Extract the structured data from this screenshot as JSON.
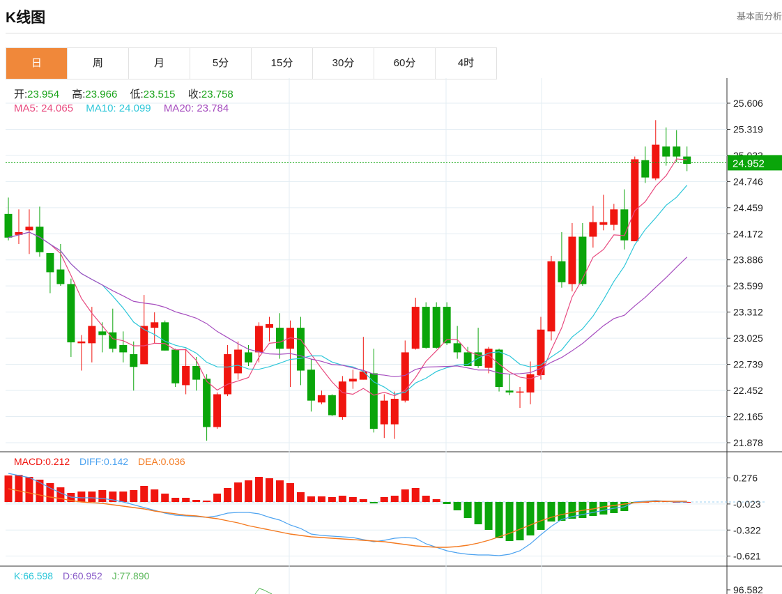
{
  "header": {
    "title": "K线图",
    "right_link": "基本面分析"
  },
  "tabs": [
    {
      "label": "日",
      "active": true
    },
    {
      "label": "周"
    },
    {
      "label": "月"
    },
    {
      "label": "5分"
    },
    {
      "label": "15分"
    },
    {
      "label": "30分"
    },
    {
      "label": "60分"
    },
    {
      "label": "4时"
    }
  ],
  "ohlc_info": {
    "open_label": "开:",
    "open": "23.954",
    "high_label": "高:",
    "high": "23.966",
    "low_label": "低:",
    "low": "23.515",
    "close_label": "收:",
    "close": "23.758"
  },
  "ma_info": {
    "ma5": "MA5: 24.065",
    "ma10": "MA10: 24.099",
    "ma20": "MA20: 23.784"
  },
  "macd_info": {
    "macd": "MACD:0.212",
    "diff": "DIFF:0.142",
    "dea": "DEA:0.036"
  },
  "kdj_info": {
    "k": "K:66.598",
    "d": "D:60.952",
    "j": "J:77.890"
  },
  "colors": {
    "up": "#f0150f",
    "down": "#0aa50a",
    "ma5": "#e84a7f",
    "ma10": "#2ec7d9",
    "ma20": "#a64dbf",
    "diff": "#4da3f0",
    "dea": "#f47a20",
    "accent": "#f0883a"
  },
  "chart_data": {
    "type": "candlestick",
    "price_ticks": [
      "25.606",
      "25.319",
      "25.033",
      "24.746",
      "24.459",
      "24.172",
      "23.886",
      "23.599",
      "23.312",
      "23.025",
      "22.739",
      "22.452",
      "22.165",
      "21.878"
    ],
    "price_range": [
      21.878,
      25.606
    ],
    "current_price": "24.952",
    "candles": [
      [
        24.39,
        24.13,
        24.57,
        24.1
      ],
      [
        24.16,
        24.19,
        24.44,
        24.06
      ],
      [
        24.21,
        24.25,
        24.44,
        23.95
      ],
      [
        24.25,
        23.97,
        24.47,
        23.92
      ],
      [
        23.96,
        23.75,
        23.96,
        23.52
      ],
      [
        23.78,
        23.62,
        24.06,
        23.6
      ],
      [
        23.62,
        22.98,
        23.68,
        22.82
      ],
      [
        22.97,
        22.99,
        23.06,
        22.67
      ],
      [
        22.97,
        23.16,
        23.37,
        22.76
      ],
      [
        23.1,
        23.06,
        23.2,
        22.87
      ],
      [
        23.09,
        22.91,
        23.35,
        22.87
      ],
      [
        22.95,
        22.87,
        23.1,
        22.76
      ],
      [
        22.85,
        22.71,
        22.99,
        22.45
      ],
      [
        22.74,
        23.16,
        23.5,
        22.74
      ],
      [
        23.14,
        23.2,
        23.31,
        22.97
      ],
      [
        23.2,
        22.89,
        23.22,
        22.89
      ],
      [
        22.9,
        22.53,
        22.91,
        22.49
      ],
      [
        22.51,
        22.72,
        22.91,
        22.41
      ],
      [
        22.72,
        22.57,
        22.82,
        22.45
      ],
      [
        22.58,
        22.05,
        22.63,
        21.9
      ],
      [
        22.05,
        22.41,
        22.43,
        22.03
      ],
      [
        22.41,
        22.85,
        22.95,
        22.39
      ],
      [
        22.64,
        22.9,
        22.99,
        22.57
      ],
      [
        22.87,
        22.76,
        22.95,
        22.72
      ],
      [
        22.87,
        23.16,
        23.2,
        22.76
      ],
      [
        23.14,
        23.18,
        23.26,
        22.99
      ],
      [
        23.14,
        22.91,
        23.3,
        22.8
      ],
      [
        22.91,
        23.14,
        23.22,
        22.49
      ],
      [
        23.14,
        22.67,
        23.26,
        22.51
      ],
      [
        22.68,
        22.34,
        22.8,
        22.22
      ],
      [
        22.32,
        22.4,
        22.45,
        22.3
      ],
      [
        22.4,
        22.18,
        22.41,
        22.17
      ],
      [
        22.16,
        22.55,
        22.61,
        22.13
      ],
      [
        22.55,
        22.58,
        22.68,
        22.47
      ],
      [
        22.57,
        22.66,
        23.04,
        22.57
      ],
      [
        22.64,
        22.03,
        22.91,
        21.99
      ],
      [
        22.08,
        22.34,
        22.41,
        21.93
      ],
      [
        22.08,
        22.36,
        22.44,
        21.92
      ],
      [
        22.34,
        22.87,
        23.0,
        22.32
      ],
      [
        22.91,
        23.37,
        23.47,
        22.9
      ],
      [
        23.37,
        22.92,
        23.42,
        22.91
      ],
      [
        23.37,
        22.92,
        23.42,
        22.91
      ],
      [
        23.37,
        22.97,
        23.42,
        22.95
      ],
      [
        22.97,
        22.87,
        23.16,
        22.8
      ],
      [
        22.87,
        22.72,
        22.93,
        22.72
      ],
      [
        22.87,
        22.72,
        23.14,
        22.7
      ],
      [
        22.7,
        22.91,
        22.93,
        22.64
      ],
      [
        22.9,
        22.49,
        22.91,
        22.44
      ],
      [
        22.45,
        22.43,
        22.63,
        22.4
      ],
      [
        22.43,
        22.44,
        22.49,
        22.26
      ],
      [
        22.43,
        22.63,
        22.77,
        22.3
      ],
      [
        22.62,
        23.12,
        23.26,
        22.57
      ],
      [
        23.1,
        23.87,
        23.93,
        23.0
      ],
      [
        23.87,
        23.64,
        24.19,
        23.58
      ],
      [
        23.62,
        24.14,
        24.29,
        23.54
      ],
      [
        24.14,
        23.62,
        24.29,
        23.6
      ],
      [
        24.14,
        24.3,
        24.48,
        24.02
      ],
      [
        24.27,
        24.3,
        24.6,
        24.21
      ],
      [
        24.27,
        24.44,
        24.5,
        24.21
      ],
      [
        24.44,
        24.1,
        24.66,
        24.0
      ],
      [
        24.09,
        24.99,
        25.02,
        24.09
      ],
      [
        24.98,
        24.79,
        25.13,
        24.73
      ],
      [
        24.78,
        25.15,
        25.42,
        24.76
      ],
      [
        25.13,
        25.02,
        25.34,
        24.92
      ],
      [
        25.13,
        25.02,
        25.31,
        24.96
      ],
      [
        25.02,
        24.94,
        25.13,
        24.86
      ]
    ],
    "macd_ticks": [
      "0.276",
      "-0.023",
      "-0.322",
      "-0.621"
    ],
    "macd_hist": [
      0.304,
      0.312,
      0.288,
      0.256,
      0.216,
      0.168,
      0.104,
      0.12,
      0.12,
      0.136,
      0.12,
      0.12,
      0.136,
      0.184,
      0.144,
      0.096,
      0.048,
      0.048,
      0.024,
      0.016,
      0.096,
      0.16,
      0.224,
      0.248,
      0.288,
      0.272,
      0.248,
      0.216,
      0.112,
      0.064,
      0.064,
      0.056,
      0.072,
      0.056,
      0.032,
      -0.016,
      0.056,
      0.072,
      0.144,
      0.16,
      0.072,
      0.032,
      -0.024,
      -0.096,
      -0.184,
      -0.256,
      -0.32,
      -0.416,
      -0.448,
      -0.44,
      -0.384,
      -0.32,
      -0.224,
      -0.216,
      -0.192,
      -0.184,
      -0.16,
      -0.144,
      -0.128,
      -0.104,
      -0.008,
      0,
      0.016,
      0.008,
      0,
      0
    ],
    "diff": [
      0.328,
      0.304,
      0.28,
      0.224,
      0.16,
      0.104,
      0.056,
      0.048,
      0.048,
      0.04,
      0.024,
      0,
      -0.032,
      -0.064,
      -0.096,
      -0.128,
      -0.152,
      -0.16,
      -0.168,
      -0.176,
      -0.16,
      -0.128,
      -0.12,
      -0.12,
      -0.136,
      -0.176,
      -0.208,
      -0.264,
      -0.304,
      -0.368,
      -0.384,
      -0.392,
      -0.4,
      -0.408,
      -0.432,
      -0.456,
      -0.44,
      -0.416,
      -0.408,
      -0.416,
      -0.48,
      -0.52,
      -0.56,
      -0.584,
      -0.6,
      -0.608,
      -0.608,
      -0.616,
      -0.6,
      -0.56,
      -0.48,
      -0.376,
      -0.28,
      -0.2,
      -0.168,
      -0.144,
      -0.12,
      -0.096,
      -0.072,
      -0.056,
      0,
      0.008,
      0.016,
      0.008,
      0,
      0
    ],
    "dea": [
      0.152,
      0.128,
      0.104,
      0.08,
      0.056,
      0.04,
      0.016,
      0,
      -0.008,
      -0.016,
      -0.032,
      -0.048,
      -0.064,
      -0.08,
      -0.104,
      -0.12,
      -0.136,
      -0.152,
      -0.16,
      -0.176,
      -0.192,
      -0.216,
      -0.24,
      -0.272,
      -0.296,
      -0.32,
      -0.344,
      -0.368,
      -0.384,
      -0.4,
      -0.408,
      -0.416,
      -0.424,
      -0.432,
      -0.44,
      -0.448,
      -0.456,
      -0.472,
      -0.488,
      -0.504,
      -0.512,
      -0.52,
      -0.52,
      -0.512,
      -0.496,
      -0.472,
      -0.44,
      -0.4,
      -0.36,
      -0.312,
      -0.264,
      -0.216,
      -0.176,
      -0.144,
      -0.12,
      -0.096,
      -0.08,
      -0.056,
      -0.04,
      -0.024,
      -0.008,
      0,
      0.008,
      0.008,
      0.008,
      0.008
    ],
    "kdj_ticks": [
      "96.582"
    ]
  }
}
